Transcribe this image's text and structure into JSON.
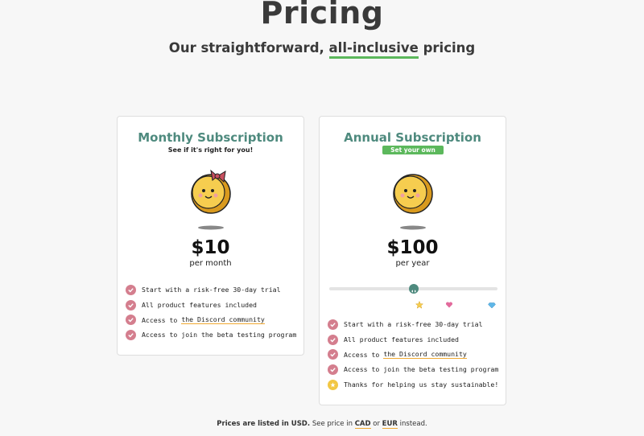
{
  "header": {
    "title": "Pricing",
    "subtitle_before": "Our straightforward,",
    "subtitle_highlight": "all-inclusive",
    "subtitle_after": "pricing"
  },
  "plans": {
    "monthly": {
      "title": "Monthly Subscription",
      "subtitle": "See if it's right for you!",
      "mascot_icon": "coin-with-bow-icon",
      "price": "$10",
      "period": "per month",
      "features": [
        {
          "text": "Start with a risk-free 30-day trial"
        },
        {
          "text": "All product features included"
        },
        {
          "pre": "Access to",
          "link": "the Discord community"
        },
        {
          "text": "Access to join the beta testing program"
        }
      ]
    },
    "annual": {
      "title": "Annual Subscription",
      "badge": "Set your own price!",
      "mascot_icon": "coin-icon",
      "price": "$100",
      "period": "per year",
      "slider_value_fraction": 0.5,
      "slider_tier_icons": [
        "star-icon",
        "heart-icon",
        "diamond-icon"
      ],
      "features": [
        {
          "text": "Start with a risk-free 30-day trial"
        },
        {
          "text": "All product features included"
        },
        {
          "pre": "Access to",
          "link": "the Discord community"
        },
        {
          "text": "Access to join the beta testing program"
        },
        {
          "text": "Thanks for helping us stay sustainable!",
          "icon": "star-badge-icon"
        }
      ]
    }
  },
  "footer": {
    "prefix": "Prices are listed in USD.",
    "middle": "See price in",
    "cad": "CAD",
    "or": "or",
    "eur": "EUR",
    "suffix": "instead."
  },
  "colors": {
    "accent_green": "#5cb85c",
    "title_teal": "#4e8a7e",
    "check_pink": "#d47e8e",
    "link_underline": "#f0a830",
    "coin_gold": "#f2c744"
  }
}
